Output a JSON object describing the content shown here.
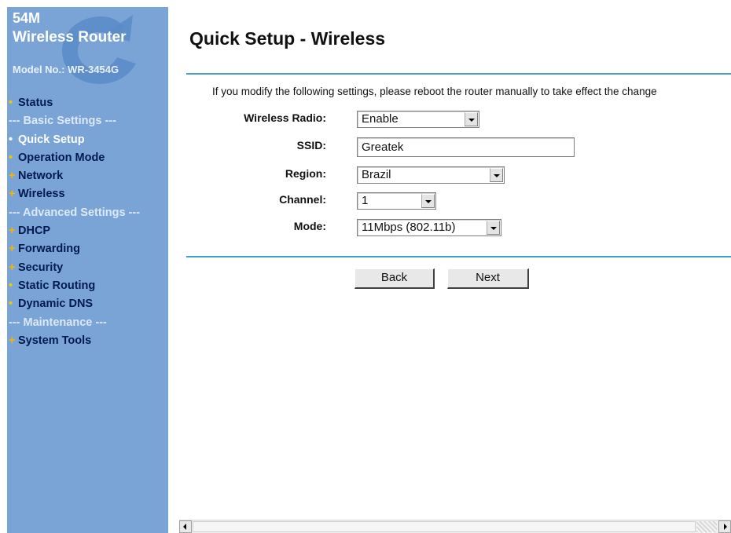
{
  "branding": {
    "speed": "54M",
    "product": "Wireless Router",
    "model": "Model No.: WR-3454G"
  },
  "nav": [
    {
      "label": "Status",
      "marker": "•",
      "type": "item",
      "active": false
    },
    {
      "label": "--- Basic Settings ---",
      "marker": "",
      "type": "header"
    },
    {
      "label": "Quick Setup",
      "marker": "•",
      "type": "item",
      "active": true
    },
    {
      "label": "Operation Mode",
      "marker": "•",
      "type": "item",
      "active": false
    },
    {
      "label": "Network",
      "marker": "+",
      "type": "item",
      "active": false
    },
    {
      "label": "Wireless",
      "marker": "+",
      "type": "item",
      "active": false
    },
    {
      "label": "--- Advanced Settings ---",
      "marker": "",
      "type": "header"
    },
    {
      "label": "DHCP",
      "marker": "+",
      "type": "item",
      "active": false
    },
    {
      "label": "Forwarding",
      "marker": "+",
      "type": "item",
      "active": false
    },
    {
      "label": "Security",
      "marker": "+",
      "type": "item",
      "active": false
    },
    {
      "label": "Static Routing",
      "marker": "•",
      "type": "item",
      "active": false
    },
    {
      "label": "Dynamic DNS",
      "marker": "•",
      "type": "item",
      "active": false
    },
    {
      "label": "--- Maintenance ---",
      "marker": "",
      "type": "header"
    },
    {
      "label": "System Tools",
      "marker": "+",
      "type": "item",
      "active": false
    }
  ],
  "page": {
    "title": "Quick Setup - Wireless",
    "notice": "If you modify the following settings, please reboot the router manually to take effect the change"
  },
  "form": {
    "wireless_radio": {
      "label": "Wireless Radio:",
      "value": "Enable"
    },
    "ssid": {
      "label": "SSID:",
      "value": "Greatek"
    },
    "region": {
      "label": "Region:",
      "value": "Brazil"
    },
    "channel": {
      "label": "Channel:",
      "value": "1"
    },
    "mode": {
      "label": "Mode:",
      "value": "11Mbps (802.11b)"
    }
  },
  "buttons": {
    "back": "Back",
    "next": "Next"
  },
  "colors": {
    "sidebar_bg": "#7aa4d6",
    "rule": "#3f9fd2",
    "bullet": "#f5c400"
  }
}
